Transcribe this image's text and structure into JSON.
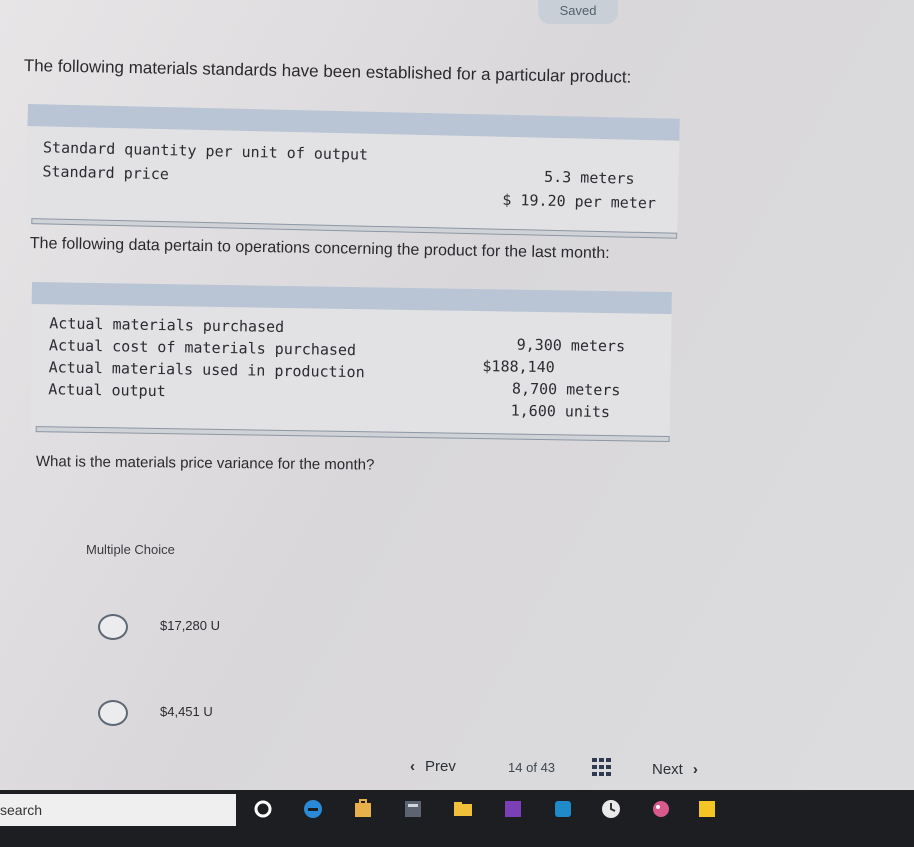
{
  "status": {
    "saved_label": "Saved"
  },
  "intro_standards": "The following materials standards have been established for a particular product:",
  "standards_table": {
    "rows": [
      {
        "label": "Standard quantity per unit of output",
        "value": "5.3 meters"
      },
      {
        "label": "Standard price",
        "value": "$ 19.20 per meter"
      }
    ]
  },
  "intro_data": "The following data pertain to operations concerning the product for the last month:",
  "actuals_table": {
    "rows": [
      {
        "label": "Actual materials purchased",
        "value": "9,300 meters"
      },
      {
        "label": "Actual cost of materials purchased",
        "value": "$188,140"
      },
      {
        "label": "Actual materials used in production",
        "value": "8,700 meters"
      },
      {
        "label": "Actual output",
        "value": "1,600 units"
      }
    ]
  },
  "question": "What is the materials price variance for the month?",
  "multiple_choice": {
    "label": "Multiple Choice",
    "options": [
      "$17,280 U",
      "$4,451 U"
    ]
  },
  "navigation": {
    "prev_label": "Prev",
    "current": "14",
    "of_word": "of",
    "total": "43",
    "next_label": "Next"
  },
  "taskbar": {
    "search_label": "search"
  },
  "icons": [
    "chevron-left-icon",
    "chevron-right-icon",
    "grid-icon",
    "edge-icon",
    "store-icon",
    "folder-icon",
    "cortana-icon"
  ]
}
